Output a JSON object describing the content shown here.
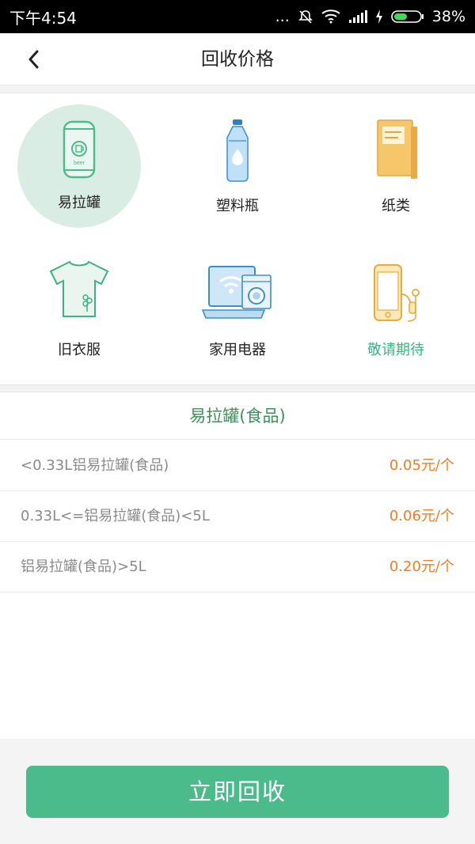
{
  "status_bar": {
    "time": "下午4:54",
    "dots": "...",
    "battery": "38%"
  },
  "header": {
    "title": "回收价格"
  },
  "categories": [
    {
      "label": "易拉罐",
      "icon": "can-icon",
      "selected": true
    },
    {
      "label": "塑料瓶",
      "icon": "bottle-icon",
      "selected": false
    },
    {
      "label": "纸类",
      "icon": "book-icon",
      "selected": false
    },
    {
      "label": "旧衣服",
      "icon": "tshirt-icon",
      "selected": false
    },
    {
      "label": "家用电器",
      "icon": "appliance-icon",
      "selected": false
    },
    {
      "label": "敬请期待",
      "icon": "phone-device-icon",
      "selected": false
    }
  ],
  "price_section": {
    "title": "易拉罐(食品)",
    "rows": [
      {
        "name": "<0.33L铝易拉罐(食品)",
        "price": "0.05元/个"
      },
      {
        "name": "0.33L<=铝易拉罐(食品)<5L",
        "price": "0.06元/个"
      },
      {
        "name": "铝易拉罐(食品)>5L",
        "price": "0.20元/个"
      }
    ]
  },
  "action": {
    "button_label": "立即回收"
  },
  "colors": {
    "accent_green": "#4cbb8b",
    "section_title_green": "#3e8f5c",
    "price_orange": "#f07c21",
    "coming_soon_green": "#3fb283"
  }
}
